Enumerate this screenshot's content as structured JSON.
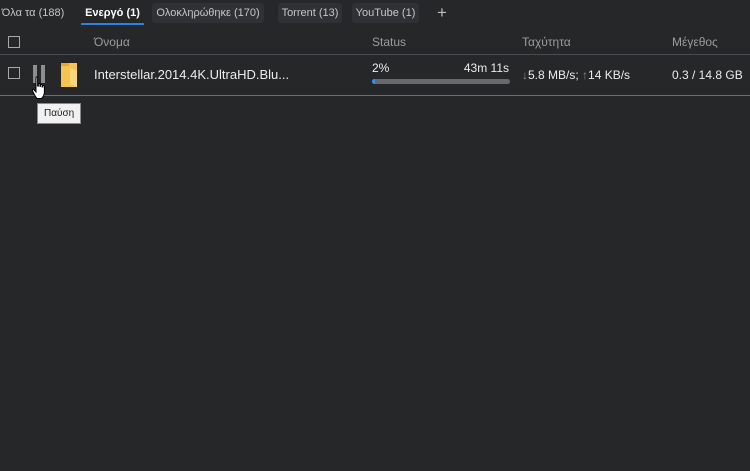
{
  "tabs": [
    {
      "label": "Όλα τα (188)",
      "active": false
    },
    {
      "label": "Ενεργό (1)",
      "active": true
    },
    {
      "label": "Ολοκληρώθηκε (170)",
      "active": false
    },
    {
      "label": "Torrent (13)",
      "active": false
    },
    {
      "label": "YouTube (1)",
      "active": false
    }
  ],
  "add_tab_label": "+",
  "columns": {
    "name": "Όνομα",
    "status": "Status",
    "speed": "Ταχύτητα",
    "size": "Μέγεθος"
  },
  "download": {
    "name": "Interstellar.2014.4K.UltraHD.Blu...",
    "percent": "2%",
    "progress_fraction": 0.02,
    "eta": "43m 11s",
    "down_arrow": "↓",
    "down_speed": "5.8 MB/s;",
    "up_arrow": "↑",
    "up_speed": "14 KB/s",
    "size": "0.3 / 14.8 GB"
  },
  "tooltip": "Παύση",
  "colors": {
    "accent": "#2f7fe0",
    "progress_fill": "#3d8ee8",
    "folder": "#f5c451"
  }
}
